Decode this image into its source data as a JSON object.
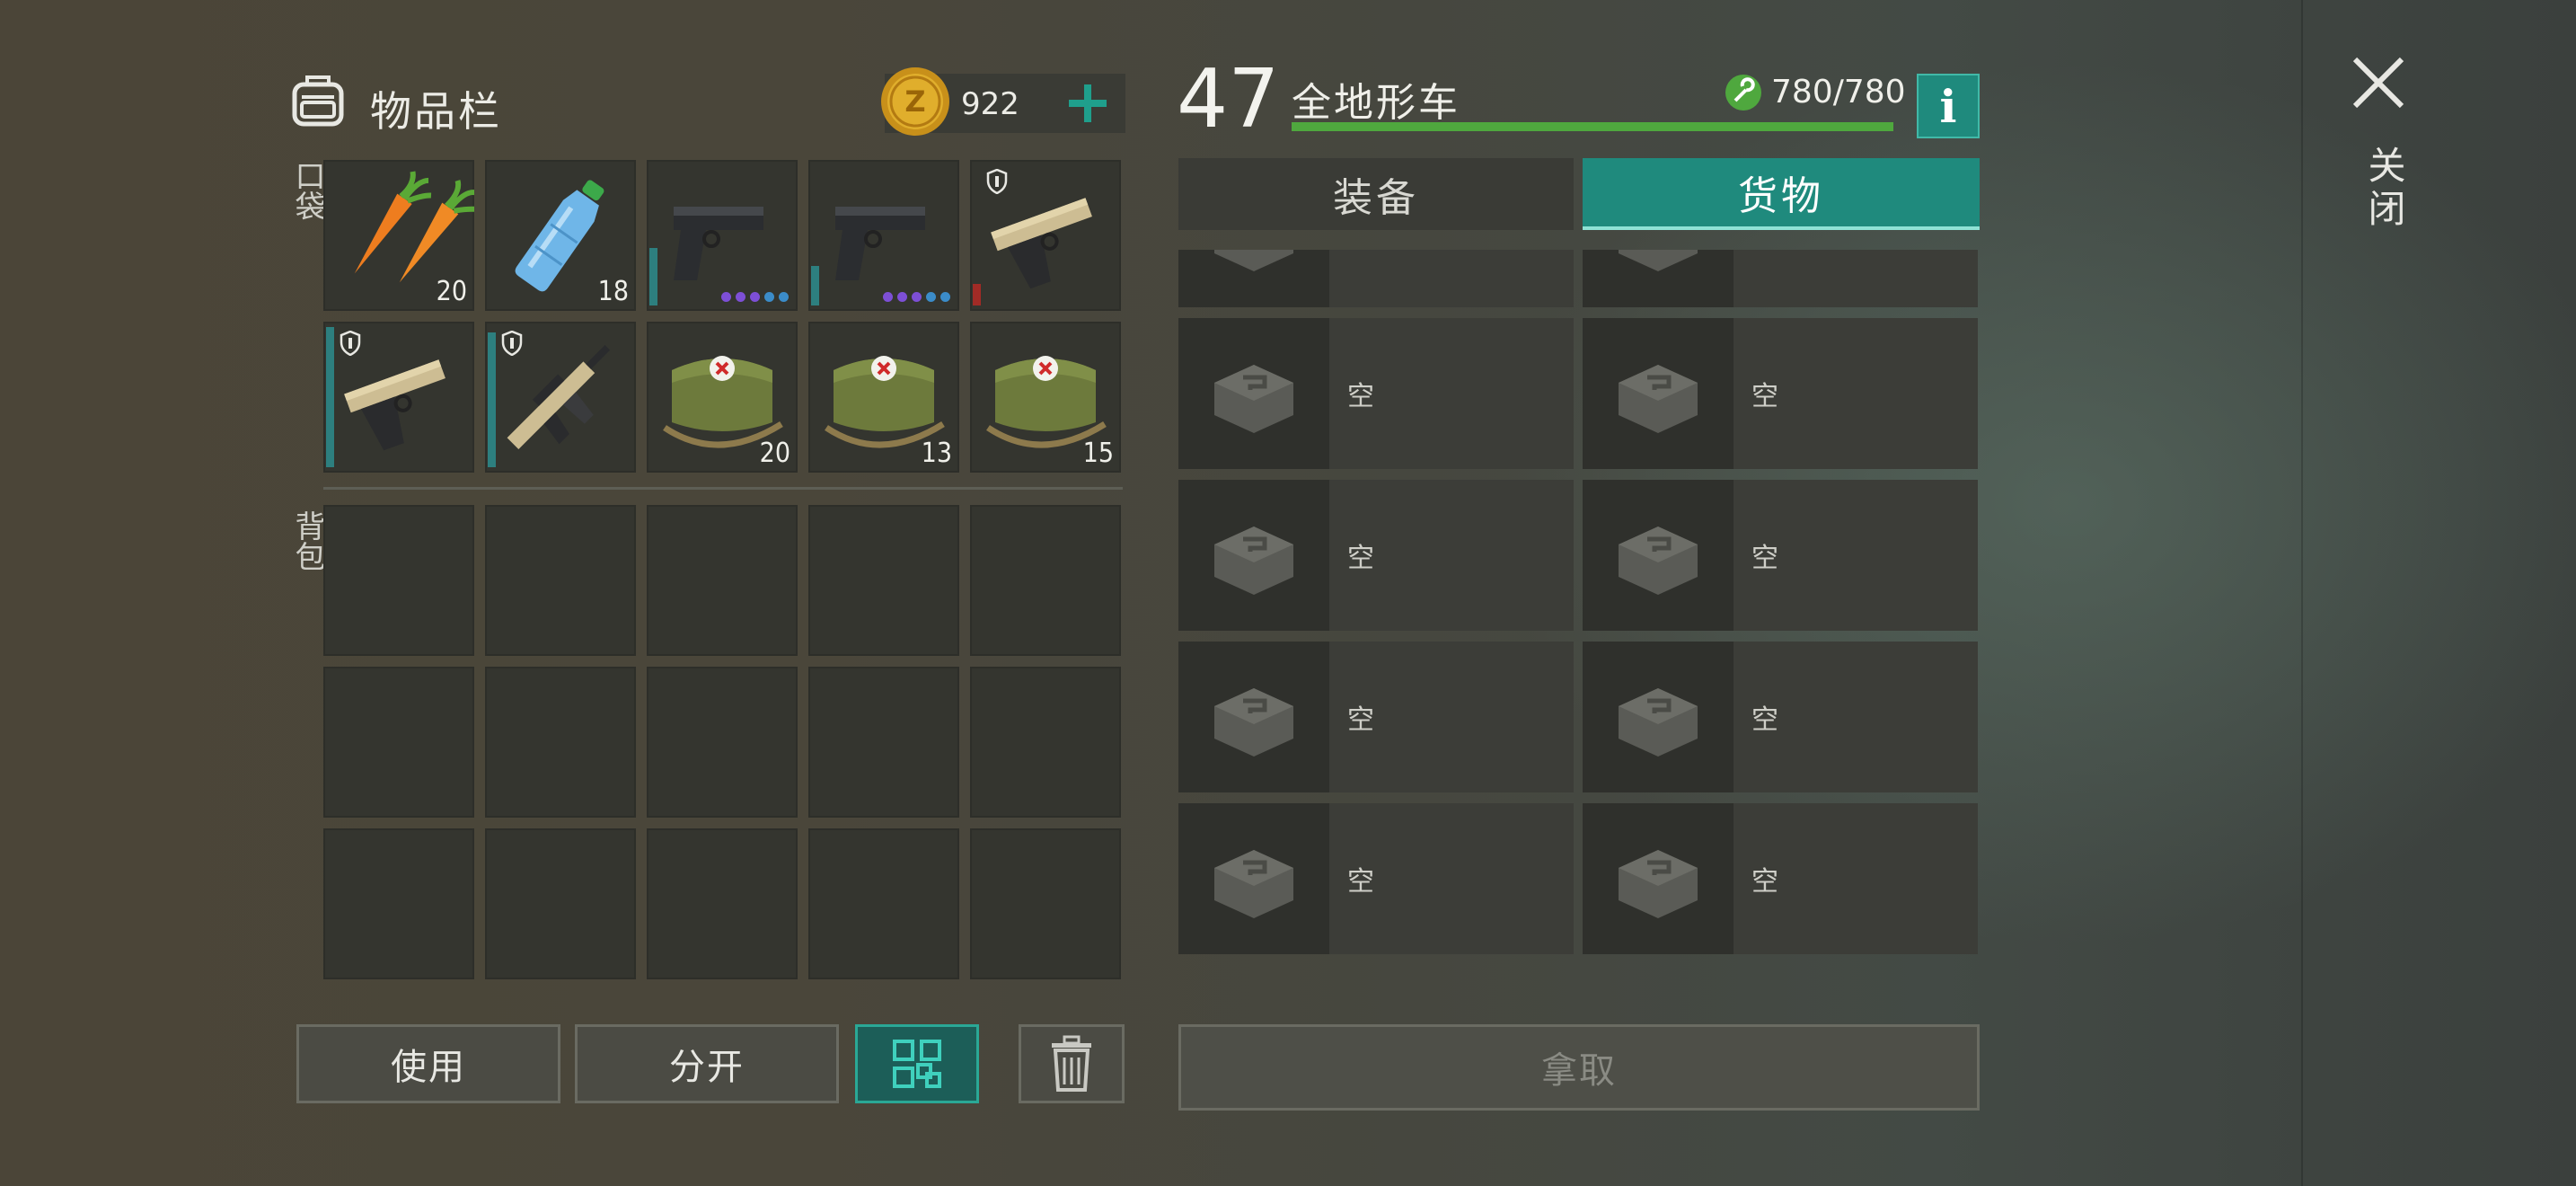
{
  "inventory": {
    "title": "物品栏",
    "coins": "922",
    "pocket_label": "口袋",
    "backpack_label": "背包",
    "pocket_items": [
      {
        "name": "carrot",
        "count": "20"
      },
      {
        "name": "water-bottle",
        "count": "18"
      },
      {
        "name": "pistol",
        "count": ""
      },
      {
        "name": "pistol",
        "count": ""
      },
      {
        "name": "desert-pistol",
        "count": ""
      },
      {
        "name": "desert-pistol",
        "count": ""
      },
      {
        "name": "assault-rifle",
        "count": ""
      },
      {
        "name": "medkit",
        "count": "20"
      },
      {
        "name": "medkit",
        "count": "13"
      },
      {
        "name": "medkit",
        "count": "15"
      }
    ],
    "dot_colors": [
      "#7d4fd6",
      "#7d4fd6",
      "#7d4fd6",
      "#3b8cc9",
      "#3b8cc9"
    ],
    "buttons": {
      "use": "使用",
      "split": "分开"
    }
  },
  "vehicle": {
    "level": "47",
    "name": "全地形车",
    "durability": "780/780",
    "durability_fraction": 1.0,
    "info_label": "i",
    "tabs": {
      "equipment": "装备",
      "cargo": "货物"
    },
    "active_tab": "cargo",
    "slots": [
      "空",
      "空",
      "空",
      "空",
      "空",
      "空",
      "空",
      "空"
    ],
    "take_label": "拿取"
  },
  "close_label": "关闭",
  "colors": {
    "accent": "#1f8a7d",
    "health_bar": "#4fa83e",
    "coin": "#d9a520"
  }
}
